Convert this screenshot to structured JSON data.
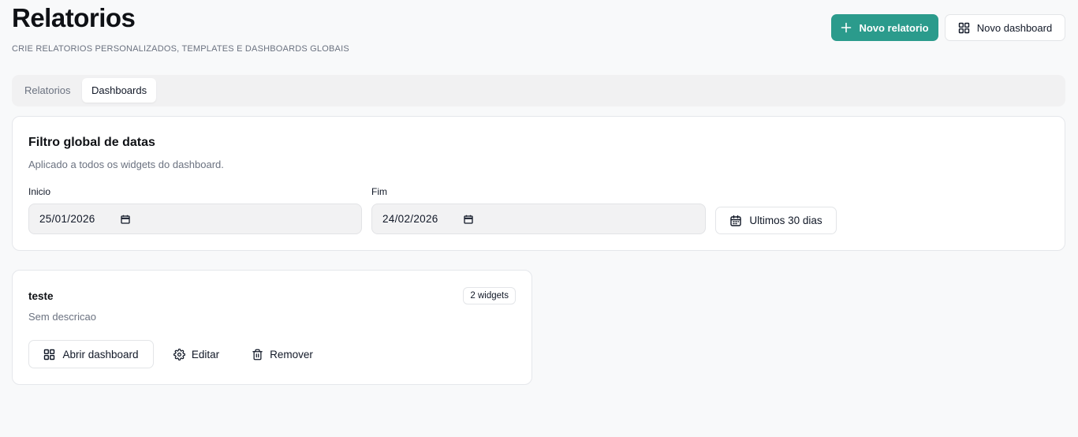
{
  "header": {
    "title": "Relatorios",
    "subtitle": "CRIE RELATORIOS PERSONALIZADOS, TEMPLATES E DASHBOARDS GLOBAIS",
    "new_report_label": "Novo relatorio",
    "new_dashboard_label": "Novo dashboard"
  },
  "tabs": [
    {
      "label": "Relatorios",
      "active": false
    },
    {
      "label": "Dashboards",
      "active": true
    }
  ],
  "filter": {
    "title": "Filtro global de datas",
    "description": "Aplicado a todos os widgets do dashboard.",
    "start_label": "Inicio",
    "start_value": "25/01/2026",
    "end_label": "Fim",
    "end_value": "24/02/2026",
    "last30_label": "Ultimos 30 dias"
  },
  "dashboards": [
    {
      "name": "teste",
      "widgets_badge": "2 widgets",
      "description": "Sem descricao",
      "open_label": "Abrir dashboard",
      "edit_label": "Editar",
      "remove_label": "Remover"
    }
  ],
  "colors": {
    "primary": "#2b9b8c",
    "background": "#f8f9fa"
  }
}
